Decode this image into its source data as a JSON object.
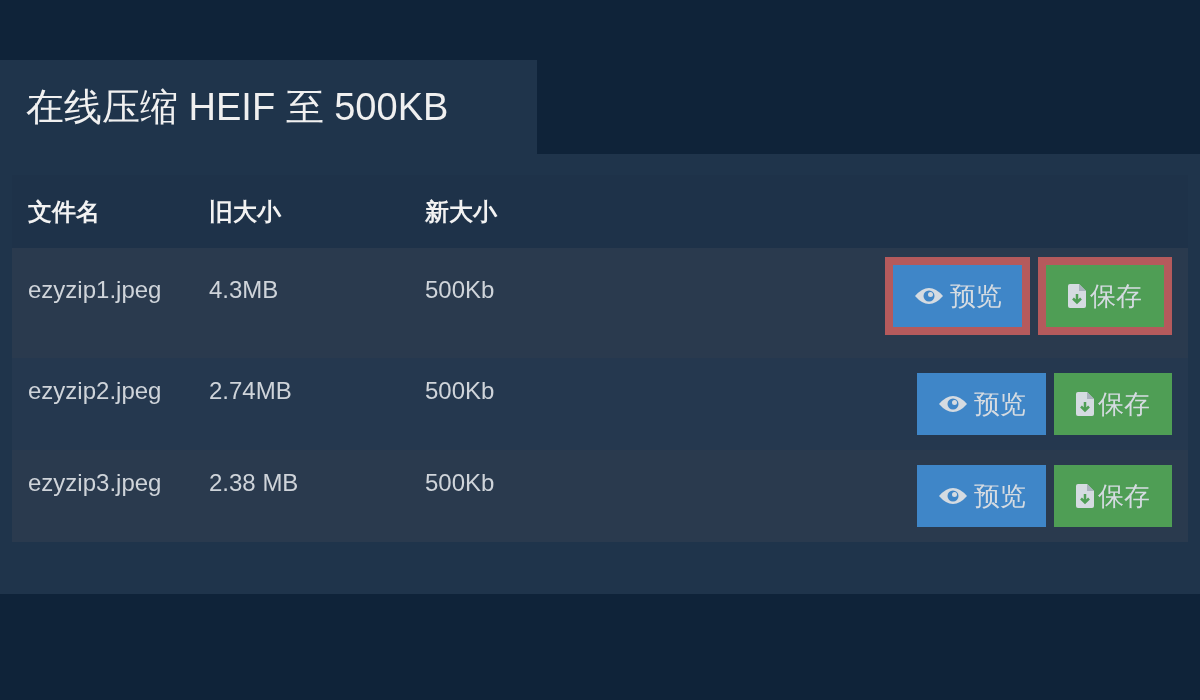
{
  "title": "在线压缩 HEIF 至 500KB",
  "table": {
    "columns": [
      "文件名",
      "旧大小",
      "新大小"
    ],
    "rows": [
      {
        "file": "ezyzip1.jpeg",
        "old_size": "4.3MB",
        "new_size": "500Kb",
        "preview": "预览",
        "save": "保存",
        "highlighted": true
      },
      {
        "file": "ezyzip2.jpeg",
        "old_size": "2.74MB",
        "new_size": "500Kb",
        "preview": "预览",
        "save": "保存",
        "highlighted": false
      },
      {
        "file": "ezyzip3.jpeg",
        "old_size": "2.38 MB",
        "new_size": "500Kb",
        "preview": "预览",
        "save": "保存",
        "highlighted": false
      }
    ]
  }
}
